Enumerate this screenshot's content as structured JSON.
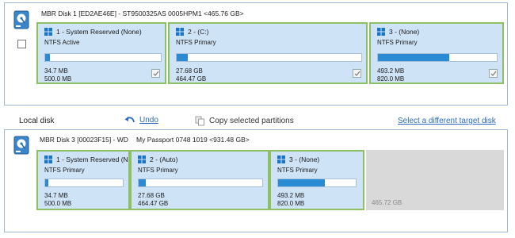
{
  "source_disk": {
    "title": "MBR Disk 1 [ED2AE46E] - ST9500325AS 0005HPM1  <465.76 GB>",
    "partitions": [
      {
        "label": "1 - System Reserved (None)",
        "type": "NTFS Active",
        "used": "34.7 MB",
        "total": "500.0 MB",
        "fill": 0.04,
        "checked": true
      },
      {
        "label": "2 -  (C:)",
        "type": "NTFS Primary",
        "used": "27.68 GB",
        "total": "464.47 GB",
        "fill": 0.06,
        "checked": true
      },
      {
        "label": "3 -  (None)",
        "type": "NTFS Primary",
        "used": "493.2 MB",
        "total": "820.0 MB",
        "fill": 0.6,
        "checked": true
      }
    ]
  },
  "toolbar": {
    "local_disk": "Local disk",
    "undo": "Undo",
    "copy_selected": "Copy selected partitions",
    "select_target": "Select a different target disk"
  },
  "target_disk": {
    "title": "MBR Disk 3 [00023F15] - WD",
    "model": "My Passport 0748 1019  <931.48 GB>",
    "partitions": [
      {
        "label": "1 - System Reserved (N",
        "type": "NTFS Primary",
        "used": "34.7 MB",
        "total": "500.0 MB",
        "fill": 0.04
      },
      {
        "label": "2 -  (Auto)",
        "type": "NTFS Primary",
        "used": "27.68 GB",
        "total": "464.47 GB",
        "fill": 0.06
      },
      {
        "label": "3 -  (None)",
        "type": "NTFS Primary",
        "used": "493.2 MB",
        "total": "820.0 MB",
        "fill": 0.6
      }
    ],
    "unallocated": "465.72 GB"
  },
  "icons": {
    "disk": "disk-icon",
    "windows": "windows-logo-icon",
    "undo": "undo-arrow-icon",
    "copy": "copy-icon",
    "check": "checkmark-icon"
  },
  "colors": {
    "partition_bg": "#cfe3f6",
    "partition_border": "#8cc063",
    "bar_fill": "#2a8ad4",
    "link": "#2a6ac0",
    "unallocated": "#d9d9d9"
  }
}
